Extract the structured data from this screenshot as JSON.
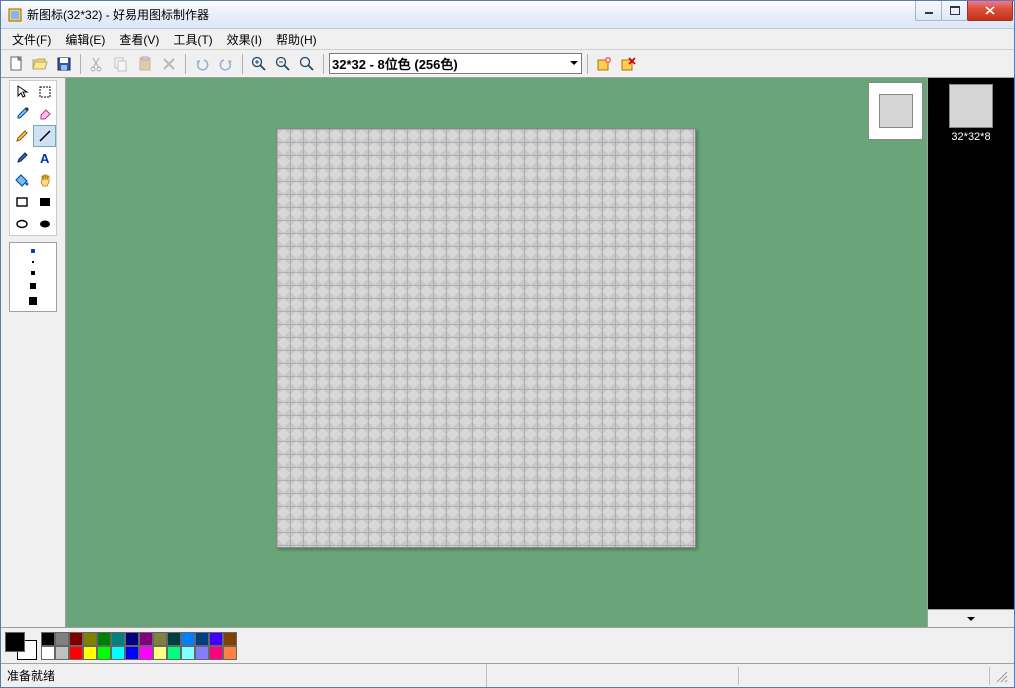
{
  "title": "新图标(32*32)  - 好易用图标制作器",
  "menu": {
    "file": "文件(F)",
    "edit": "编辑(E)",
    "view": "查看(V)",
    "tools": "工具(T)",
    "effects": "效果(I)",
    "help": "帮助(H)"
  },
  "toolbar": {
    "size_selected": "32*32 - 8位色 (256色)"
  },
  "right_panel": {
    "thumb_label": "32*32*8"
  },
  "status": {
    "ready": "准备就绪"
  },
  "palette": {
    "row1": [
      "#000000",
      "#808080",
      "#800000",
      "#808000",
      "#008000",
      "#008080",
      "#000080",
      "#800080",
      "#808040",
      "#004040",
      "#0080ff",
      "#004080",
      "#4000ff",
      "#804000"
    ],
    "row2": [
      "#ffffff",
      "#c0c0c0",
      "#ff0000",
      "#ffff00",
      "#00ff00",
      "#00ffff",
      "#0000ff",
      "#ff00ff",
      "#ffff80",
      "#00ff80",
      "#80ffff",
      "#8080ff",
      "#ff0080",
      "#ff8040"
    ]
  }
}
